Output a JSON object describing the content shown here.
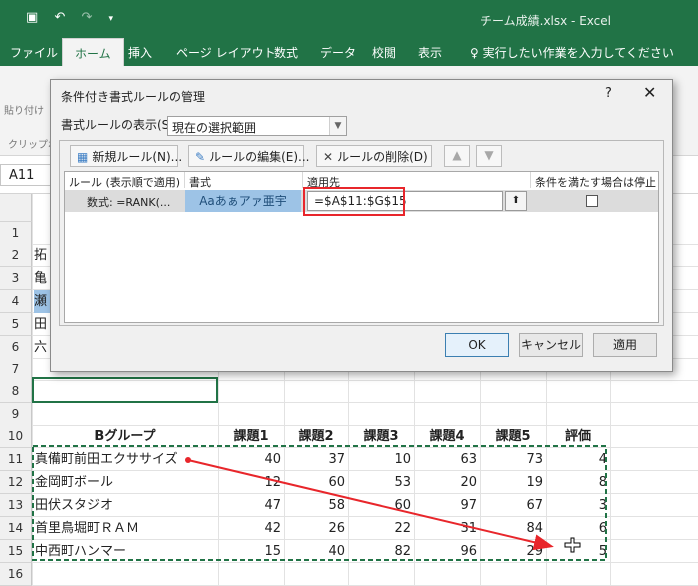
{
  "window": {
    "title": "チーム成績.xlsx  -  Excel",
    "qat_icons": [
      "save-icon",
      "undo-icon",
      "redo-icon",
      "customize-icon"
    ]
  },
  "ribbon": {
    "tabs": [
      "ファイル",
      "ホーム",
      "挿入",
      "ページ レイアウト",
      "数式",
      "データ",
      "校閲",
      "表示"
    ],
    "tell_me": "実行したい作業を入力してください",
    "paste_label": "貼り付け",
    "clipboard_label": "クリップボ"
  },
  "formula": {
    "cell_ref": "A11"
  },
  "sheet": {
    "row_numbers": [
      "1",
      "2",
      "3",
      "4",
      "5",
      "6",
      "7",
      "8",
      "9",
      "10",
      "11",
      "12",
      "13",
      "14",
      "15",
      "16"
    ],
    "col_a_partial": [
      "拓",
      "亀",
      "瀬",
      "田",
      "六"
    ],
    "headers": [
      "Bグループ",
      "課題1",
      "課題2",
      "課題3",
      "課題4",
      "課題5",
      "評価"
    ],
    "rows": [
      [
        "真備町前田エクササイズ",
        "40",
        "37",
        "10",
        "63",
        "73",
        "4"
      ],
      [
        "金岡町ボール",
        "12",
        "60",
        "53",
        "20",
        "19",
        "8"
      ],
      [
        "田伏スタジオ",
        "47",
        "58",
        "60",
        "97",
        "67",
        "3"
      ],
      [
        "首里鳥堀町ＲＡＭ",
        "42",
        "26",
        "22",
        "31",
        "84",
        "6"
      ],
      [
        "中西町ハンマー",
        "15",
        "40",
        "82",
        "96",
        "29",
        "5"
      ]
    ]
  },
  "dialog": {
    "title": "条件付き書式ルールの管理",
    "help": "?",
    "close": "✕",
    "show_rules_label": "書式ルールの表示(S):",
    "show_rules_value": "現在の選択範囲",
    "buttons": {
      "new_rule": "新規ルール(N)...",
      "edit_rule": "ルールの編集(E)...",
      "delete_rule": "ルールの削除(D)",
      "ok": "OK",
      "cancel": "キャンセル",
      "apply": "適用"
    },
    "columns": {
      "rule": "ルール (表示順で適用)",
      "format": "書式",
      "applies_to": "適用先",
      "stop_if_true": "条件を満たす場合は停止"
    },
    "rule_row": {
      "rule": "数式: =RANK(...",
      "format_preview": "Aaあぁアァ亜宇",
      "applies_to": "=$A$11:$G$15"
    }
  },
  "colors": {
    "excel_green": "#217346",
    "highlight_red": "#e8262b",
    "format_preview_bg": "#9dc3e6",
    "marching_ants": "#217346"
  }
}
